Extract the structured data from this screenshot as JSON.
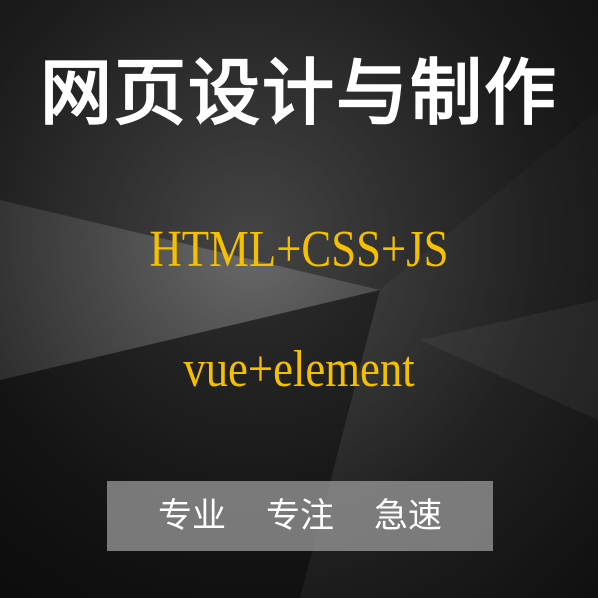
{
  "title": "网页设计与制作",
  "line1": "HTML+CSS+JS",
  "line2": "vue+element",
  "tags": [
    "专业",
    "专注",
    "急速"
  ],
  "colors": {
    "title": "#ffffff",
    "highlight": "#f5c000",
    "tag_text": "#ffffff",
    "tag_box": "#969696"
  }
}
